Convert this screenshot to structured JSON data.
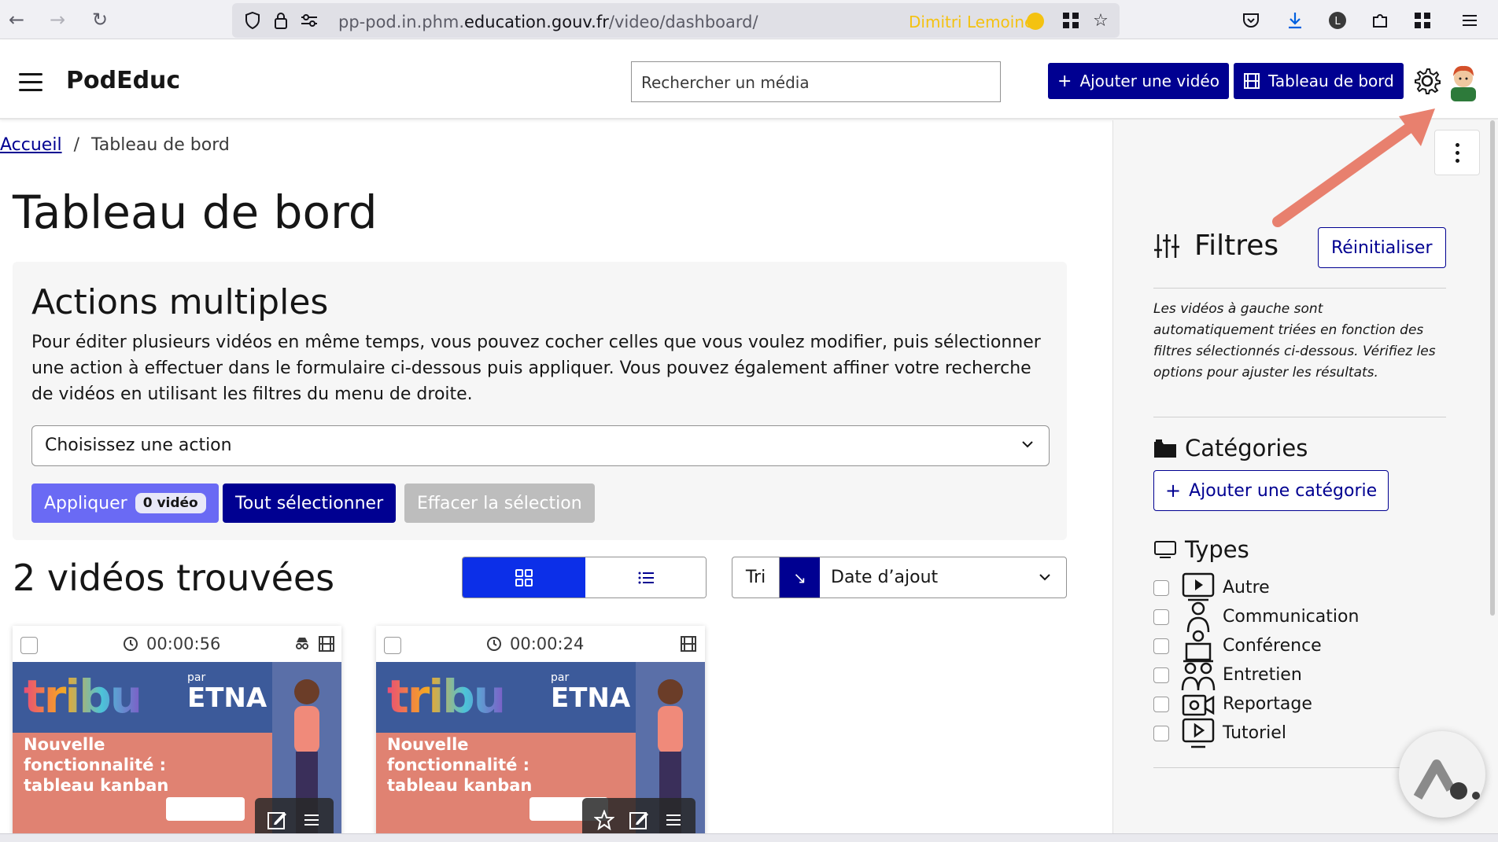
{
  "browser": {
    "url_prefix": "pp-pod.in.phm.",
    "url_domain": "education.gouv.fr",
    "url_path": "/video/dashboard/",
    "user": "Dimitri Lemoine"
  },
  "header": {
    "brand": "PodEduc",
    "search_placeholder": "Rechercher un média",
    "add_video": "Ajouter une vidéo",
    "dashboard": "Tableau de bord"
  },
  "breadcrumb": {
    "home": "Accueil",
    "separator": "/",
    "current": "Tableau de bord"
  },
  "page_title": "Tableau de bord",
  "actions": {
    "title": "Actions multiples",
    "description": "Pour éditer plusieurs vidéos en même temps, vous pouvez cocher celles que vous voulez modifier, puis sélectionner une action à effectuer dans le formulaire ci-dessous puis appliquer. Vous pouvez également affiner votre recherche de vidéos en utilisant les filtres du menu de droite.",
    "select_placeholder": "Choisissez une action",
    "apply": "Appliquer",
    "apply_badge": "0 vidéo",
    "select_all": "Tout sélectionner",
    "clear_selection": "Effacer la sélection"
  },
  "results": {
    "title": "2 vidéos trouvées",
    "sort_label": "Tri",
    "sort_dir": "↘",
    "sort_value": "Date d’ajout"
  },
  "videos": [
    {
      "duration": "00:00:56",
      "logo": "tribu",
      "par": "par",
      "etna": "ETNA",
      "title": "Nouvelle fonctionnalité : tableau kanban"
    },
    {
      "duration": "00:00:24",
      "logo": "tribu",
      "par": "par",
      "etna": "ETNA",
      "title": "Nouvelle fonctionnalité : tableau kanban"
    }
  ],
  "sidebar": {
    "filters_title": "Filtres",
    "reset": "Réinitialiser",
    "description": "Les vidéos à gauche sont automatiquement triées en fonction des filtres sélectionnés ci-dessous. Vérifiez les options pour ajuster les résultats.",
    "categories_title": "Catégories",
    "add_category": "Ajouter une catégorie",
    "types_title": "Types",
    "types": [
      "Autre",
      "Communication",
      "Conférence",
      "Entretien",
      "Reportage",
      "Tutoriel"
    ]
  },
  "colors": {
    "primary": "#000091",
    "apply": "#6a6af4",
    "grid_active": "#0c2fe8",
    "thumb_top": "#3c5a9a",
    "thumb_bottom": "#e08272",
    "arrow": "#e8806e"
  }
}
